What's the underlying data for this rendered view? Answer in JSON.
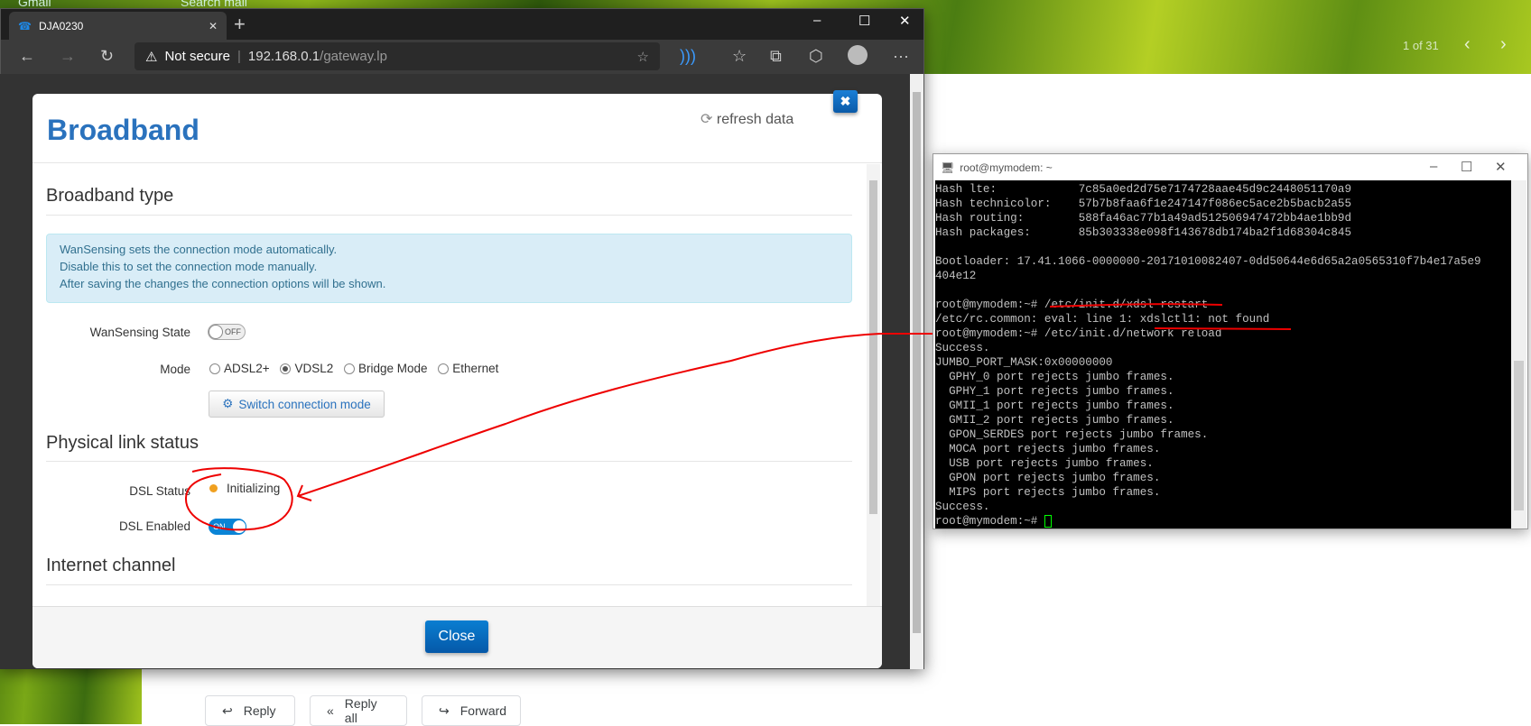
{
  "background": {
    "gmail_label": "Gmail",
    "search_placeholder": "Search mail",
    "pager": "1 of 31",
    "mail_actions": {
      "reply": "Reply",
      "reply_all": "Reply all",
      "forward": "Forward"
    }
  },
  "browser": {
    "tab_title": "DJA0230",
    "security_label": "Not secure",
    "url_host": "192.168.0.1",
    "url_path": "/gateway.lp"
  },
  "modal": {
    "title": "Broadband",
    "refresh_label": "refresh data",
    "sections": {
      "broadband_type": "Broadband type",
      "physical_link": "Physical link status",
      "internet_channel": "Internet channel"
    },
    "info_lines": [
      "WanSensing sets the connection mode automatically.",
      "Disable this to set the connection mode manually.",
      "After saving the changes the connection options will be shown."
    ],
    "wansensing": {
      "label": "WanSensing State",
      "value": "OFF"
    },
    "mode": {
      "label": "Mode",
      "options": [
        "ADSL2+",
        "VDSL2",
        "Bridge Mode",
        "Ethernet"
      ],
      "selected": "VDSL2"
    },
    "switch_button": "Switch connection mode",
    "dsl_status": {
      "label": "DSL Status",
      "value": "Initializing",
      "color": "#f0a020"
    },
    "dsl_enabled": {
      "label": "DSL Enabled",
      "value": "ON"
    },
    "close_button": "Close",
    "accent": "#2a72bd"
  },
  "terminal": {
    "title": "root@mymodem: ~",
    "lines": [
      "Hash lte:            7c85a0ed2d75e7174728aae45d9c2448051170a9",
      "Hash technicolor:    57b7b8faa6f1e247147f086ec5ace2b5bacb2a55",
      "Hash routing:        588fa46ac77b1a49ad512506947472bb4ae1bb9d",
      "Hash packages:       85b303338e098f143678db174ba2f1d68304c845",
      "",
      "Bootloader: 17.41.1066-0000000-20171010082407-0dd50644e6d65a2a0565310f7b4e17a5e9",
      "404e12",
      "",
      "root@mymodem:~# /etc/init.d/xdsl restart",
      "/etc/rc.common: eval: line 1: xdslctl1: not found",
      "root@mymodem:~# /etc/init.d/network reload",
      "Success.",
      "JUMBO_PORT_MASK:0x00000000",
      "  GPHY_0 port rejects jumbo frames.",
      "  GPHY_1 port rejects jumbo frames.",
      "  GMII_1 port rejects jumbo frames.",
      "  GMII_2 port rejects jumbo frames.",
      "  GPON_SERDES port rejects jumbo frames.",
      "  MOCA port rejects jumbo frames.",
      "  USB port rejects jumbo frames.",
      "  GPON port rejects jumbo frames.",
      "  MIPS port rejects jumbo frames.",
      "Success."
    ],
    "prompt": "root@mymodem:~# "
  }
}
